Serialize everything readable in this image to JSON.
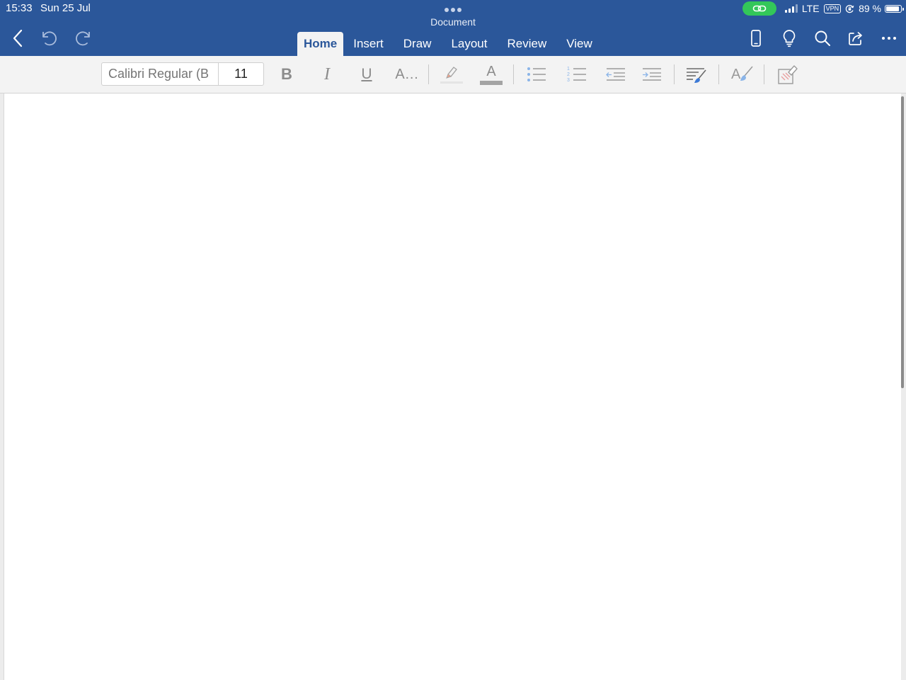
{
  "status_bar": {
    "time": "15:33",
    "date": "Sun 25 Jul",
    "network": "LTE",
    "vpn_label": "VPN",
    "battery_text": "89 %",
    "battery_level": 0.89,
    "hotspot_color": "#33c759"
  },
  "app": {
    "title": "Document",
    "accent_color": "#2b579a"
  },
  "nav": {
    "back_icon": "chevron-left-icon",
    "undo_icon": "undo-icon",
    "redo_icon": "redo-icon"
  },
  "tabs": [
    {
      "label": "Home",
      "active": true
    },
    {
      "label": "Insert",
      "active": false
    },
    {
      "label": "Draw",
      "active": false
    },
    {
      "label": "Layout",
      "active": false
    },
    {
      "label": "Review",
      "active": false
    },
    {
      "label": "View",
      "active": false
    }
  ],
  "header_icons": [
    "phone-icon",
    "lightbulb-icon",
    "search-icon",
    "share-icon",
    "more-icon"
  ],
  "ribbon": {
    "font_name_placeholder": "Calibri Regular (B",
    "font_size": "11",
    "bold_label": "B",
    "italic_label": "I",
    "underline_label": "U",
    "text_effects_label": "A…",
    "font_color_label": "A",
    "style_label": "A"
  }
}
